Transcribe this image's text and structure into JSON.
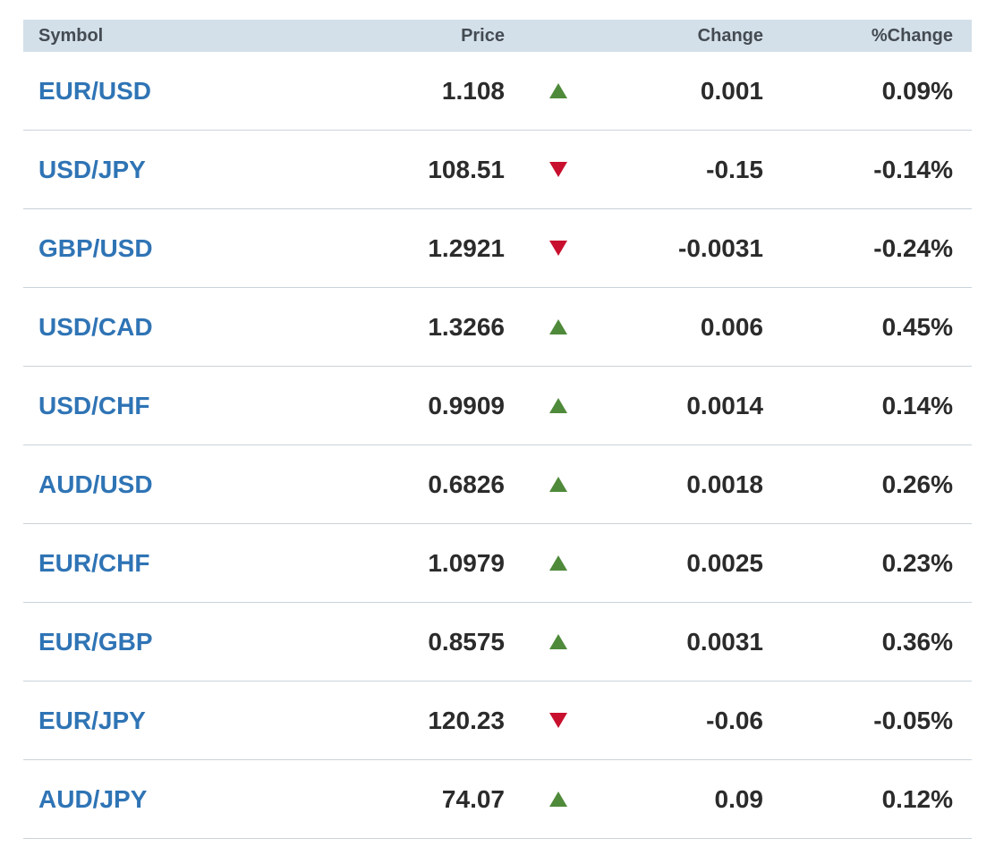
{
  "header": {
    "symbol": "Symbol",
    "price": "Price",
    "change": "Change",
    "pct_change": "%Change"
  },
  "colors": {
    "symbol_link": "#2f74b5",
    "up": "#4f8a3a",
    "down": "#c8102e",
    "header_bg": "#d4e0e9"
  },
  "rows": [
    {
      "symbol": "EUR/USD",
      "price": "1.108",
      "direction": "up",
      "change": "0.001",
      "pct_change": "0.09%"
    },
    {
      "symbol": "USD/JPY",
      "price": "108.51",
      "direction": "down",
      "change": "-0.15",
      "pct_change": "-0.14%"
    },
    {
      "symbol": "GBP/USD",
      "price": "1.2921",
      "direction": "down",
      "change": "-0.0031",
      "pct_change": "-0.24%"
    },
    {
      "symbol": "USD/CAD",
      "price": "1.3266",
      "direction": "up",
      "change": "0.006",
      "pct_change": "0.45%"
    },
    {
      "symbol": "USD/CHF",
      "price": "0.9909",
      "direction": "up",
      "change": "0.0014",
      "pct_change": "0.14%"
    },
    {
      "symbol": "AUD/USD",
      "price": "0.6826",
      "direction": "up",
      "change": "0.0018",
      "pct_change": "0.26%"
    },
    {
      "symbol": "EUR/CHF",
      "price": "1.0979",
      "direction": "up",
      "change": "0.0025",
      "pct_change": "0.23%"
    },
    {
      "symbol": "EUR/GBP",
      "price": "0.8575",
      "direction": "up",
      "change": "0.0031",
      "pct_change": "0.36%"
    },
    {
      "symbol": "EUR/JPY",
      "price": "120.23",
      "direction": "down",
      "change": "-0.06",
      "pct_change": "-0.05%"
    },
    {
      "symbol": "AUD/JPY",
      "price": "74.07",
      "direction": "up",
      "change": "0.09",
      "pct_change": "0.12%"
    }
  ]
}
